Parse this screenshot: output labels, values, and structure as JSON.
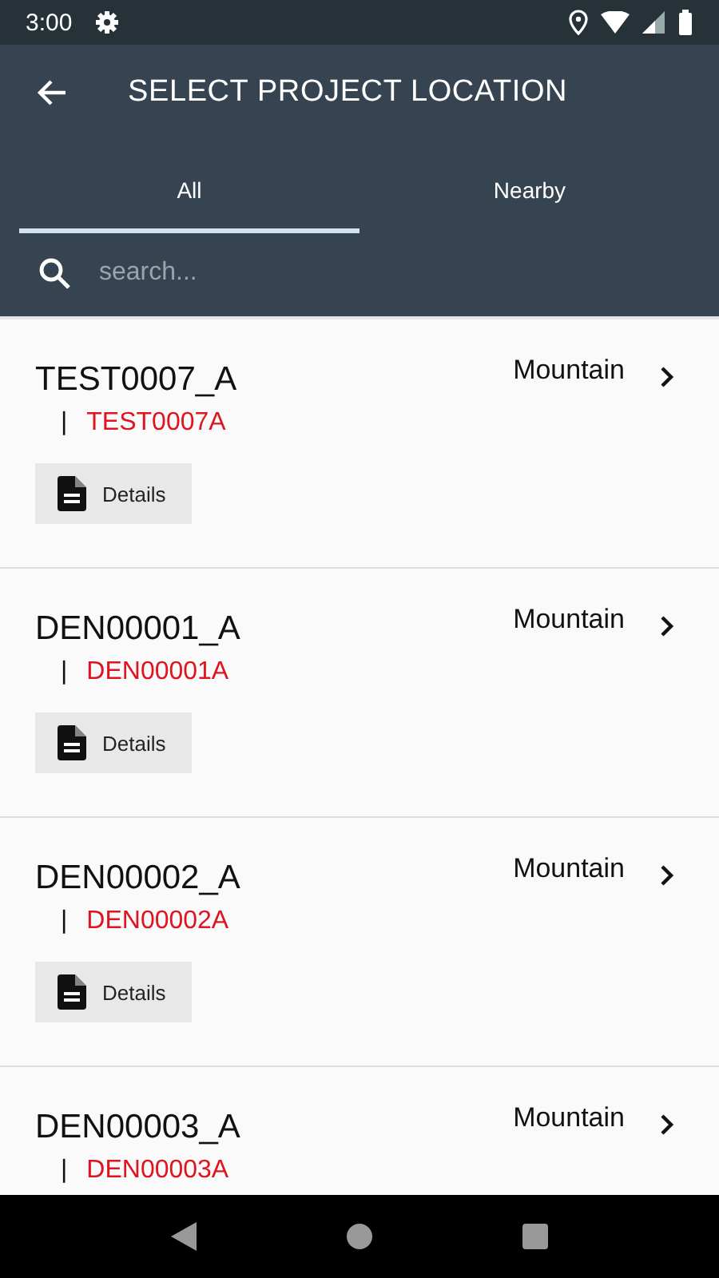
{
  "status_bar": {
    "time": "3:00"
  },
  "app_bar": {
    "title": "SELECT PROJECT LOCATION"
  },
  "tabs": [
    {
      "label": "All",
      "selected": true
    },
    {
      "label": "Nearby",
      "selected": false
    }
  ],
  "search": {
    "placeholder": "search..."
  },
  "locations": [
    {
      "name": "TEST0007_A",
      "separator": "|",
      "code": "TEST0007A",
      "region": "Mountain",
      "details": "Details"
    },
    {
      "name": "DEN00001_A",
      "separator": "|",
      "code": "DEN00001A",
      "region": "Mountain",
      "details": "Details"
    },
    {
      "name": "DEN00002_A",
      "separator": "|",
      "code": "DEN00002A",
      "region": "Mountain",
      "details": "Details"
    },
    {
      "name": "DEN00003_A",
      "separator": "|",
      "code": "DEN00003A",
      "region": "Mountain"
    }
  ]
}
